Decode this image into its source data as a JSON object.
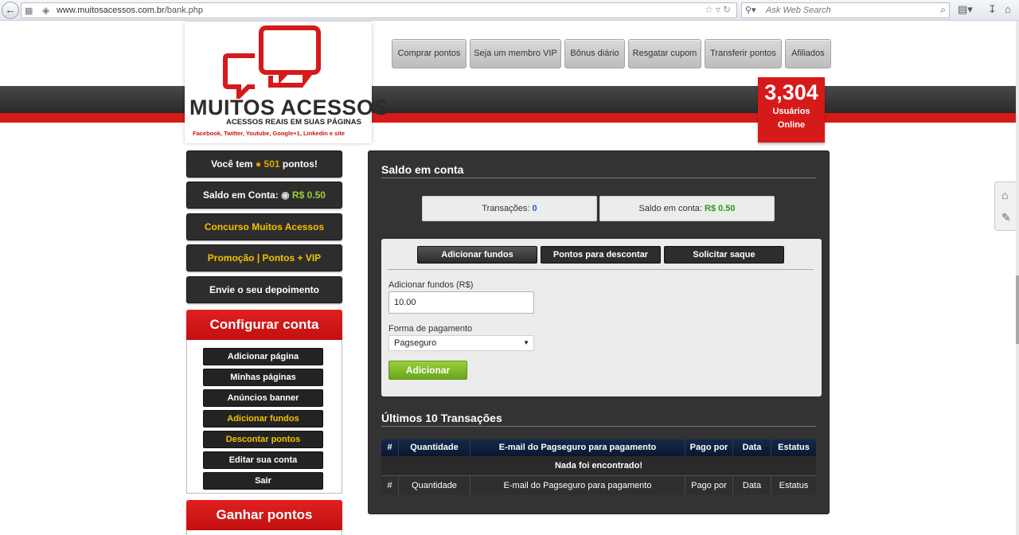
{
  "browser": {
    "url_host": "www.muitosacessos.com.br",
    "url_path": "/bank.php",
    "search_placeholder": "Ask Web Search"
  },
  "header": {
    "logo_title": "MUITOS ACESSOS",
    "logo_subtitle": "ACESSOS REAIS EM SUAS PÁGINAS",
    "logo_social": "Facebook, Twitter, Youtube, Google+1, Linkedin e site",
    "nav": [
      "Comprar pontos",
      "Seja um membro VIP",
      "Bônus diário",
      "Resgatar cupom",
      "Transferir pontos",
      "Afiliados"
    ],
    "online_count": "3,304",
    "online_label_1": "Usuários",
    "online_label_2": "Online"
  },
  "sidebar": {
    "points_prefix": "Você tem",
    "points_value": "501",
    "points_suffix": "pontos!",
    "balance_prefix": "Saldo em Conta:",
    "balance_value": "R$ 0.50",
    "contest": "Concurso Muitos Acessos",
    "promo": "Promoção | Pontos + VIP",
    "testimonial": "Envie o seu depoimento",
    "config_title": "Configurar conta",
    "config_items": [
      "Adicionar página",
      "Minhas páginas",
      "Anúncios banner",
      "Adicionar fundos",
      "Descontar pontos",
      "Editar sua conta",
      "Sair"
    ],
    "earn_title": "Ganhar pontos"
  },
  "main": {
    "title": "Saldo em conta",
    "transactions_label": "Transações:",
    "transactions_value": "0",
    "balance_label": "Saldo em conta:",
    "balance_value": "R$ 0.50",
    "tabs": [
      "Adicionar fundos",
      "Pontos para descontar",
      "Solicitar saque"
    ],
    "amount_label": "Adicionar fundos (R$)",
    "amount_value": "10.00",
    "payment_label": "Forma de pagamento",
    "payment_value": "Pagseguro",
    "add_button": "Adicionar",
    "history_title": "Últimos 10 Transações",
    "columns": [
      "#",
      "Quantidade",
      "E-mail do Pagseguro para pagamento",
      "Pago por",
      "Data",
      "Estatus"
    ],
    "empty_message": "Nada foi encontrado!"
  },
  "colors": {
    "brand_red": "#d61a1a",
    "accent_yellow": "#f3c200",
    "add_green": "#7ab528",
    "panel_dark": "#333333"
  }
}
